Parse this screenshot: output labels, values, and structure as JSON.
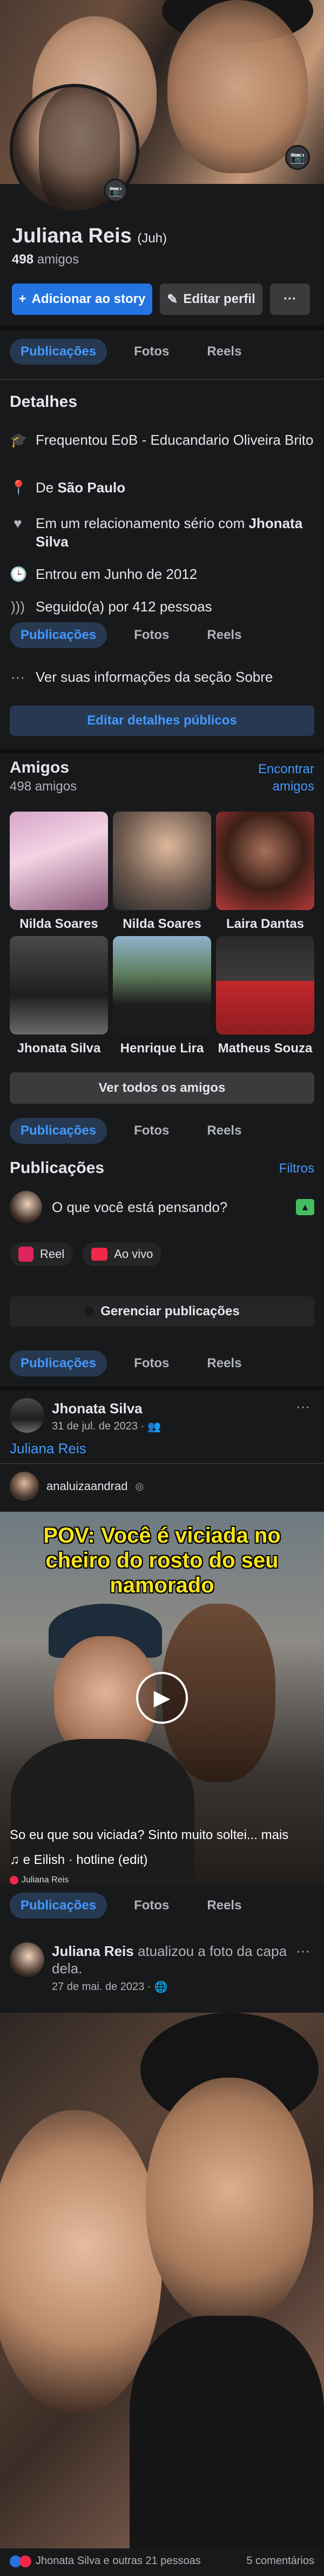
{
  "profile": {
    "name": "Juliana Reis",
    "nickname": "(Juh)",
    "friends_count": "498",
    "friends_label": "amigos",
    "add_story_label": "Adicionar ao story",
    "edit_profile_label": "Editar perfil",
    "more_label": "···"
  },
  "tabs": {
    "posts": "Publicações",
    "photos": "Fotos",
    "reels": "Reels"
  },
  "details": {
    "title": "Detalhes",
    "items": [
      {
        "icon": "graduation-cap-icon",
        "text": "Frequentou EoB - Educandario Oliveira Brito"
      },
      {
        "icon": "location-pin-icon",
        "prefix": "De ",
        "bold": "São Paulo"
      },
      {
        "icon": "heart-icon",
        "prefix": "Em um relacionamento sério com ",
        "bold": "Jhonata Silva"
      },
      {
        "icon": "clock-icon",
        "text": "Entrou em Junho de 2012"
      },
      {
        "icon": "rss-icon",
        "text": "Seguido(a) por 412 pessoas"
      }
    ],
    "see_about": "Ver suas informações da seção Sobre",
    "edit_details": "Editar detalhes públicos"
  },
  "friends": {
    "title": "Amigos",
    "count": "498 amigos",
    "find": "Encontrar amigos",
    "items": [
      "Nilda Soares",
      "Nilda Soares",
      "Laira Dantas",
      "Jhonata Silva",
      "Henrique Lira",
      "Matheus Souza"
    ],
    "see_all": "Ver todos os amigos"
  },
  "posts": {
    "title": "Publicações",
    "filters": "Filtros",
    "composer_placeholder": "O que você está pensando?",
    "reel_label": "Reel",
    "live_label": "Ao vivo",
    "manage_label": "Gerenciar publicações"
  },
  "post1": {
    "author": "Jhonata Silva",
    "date": "31 de jul. de 2023 ·",
    "tagged": "Juliana Reis",
    "reel_user": "analuizaandrad",
    "reel_caption": "POV: Você é viciada no cheiro do rosto do seu namorado",
    "description": "So eu que sou viciada? Sinto muito soltei... mais",
    "music": "♫ e Eilish · hotline (edit)",
    "footer_name": "Juliana Reis"
  },
  "post2": {
    "author": "Juliana Reis",
    "action": " atualizou a foto da capa dela.",
    "date": "27 de mai. de 2023 ·",
    "reactions": "Jhonata Silva e outras 21 pessoas",
    "comments": "5 comentários"
  },
  "colors": {
    "accent": "#2374e1",
    "link": "#4599ff",
    "background": "#18191a",
    "card": "#242526"
  }
}
